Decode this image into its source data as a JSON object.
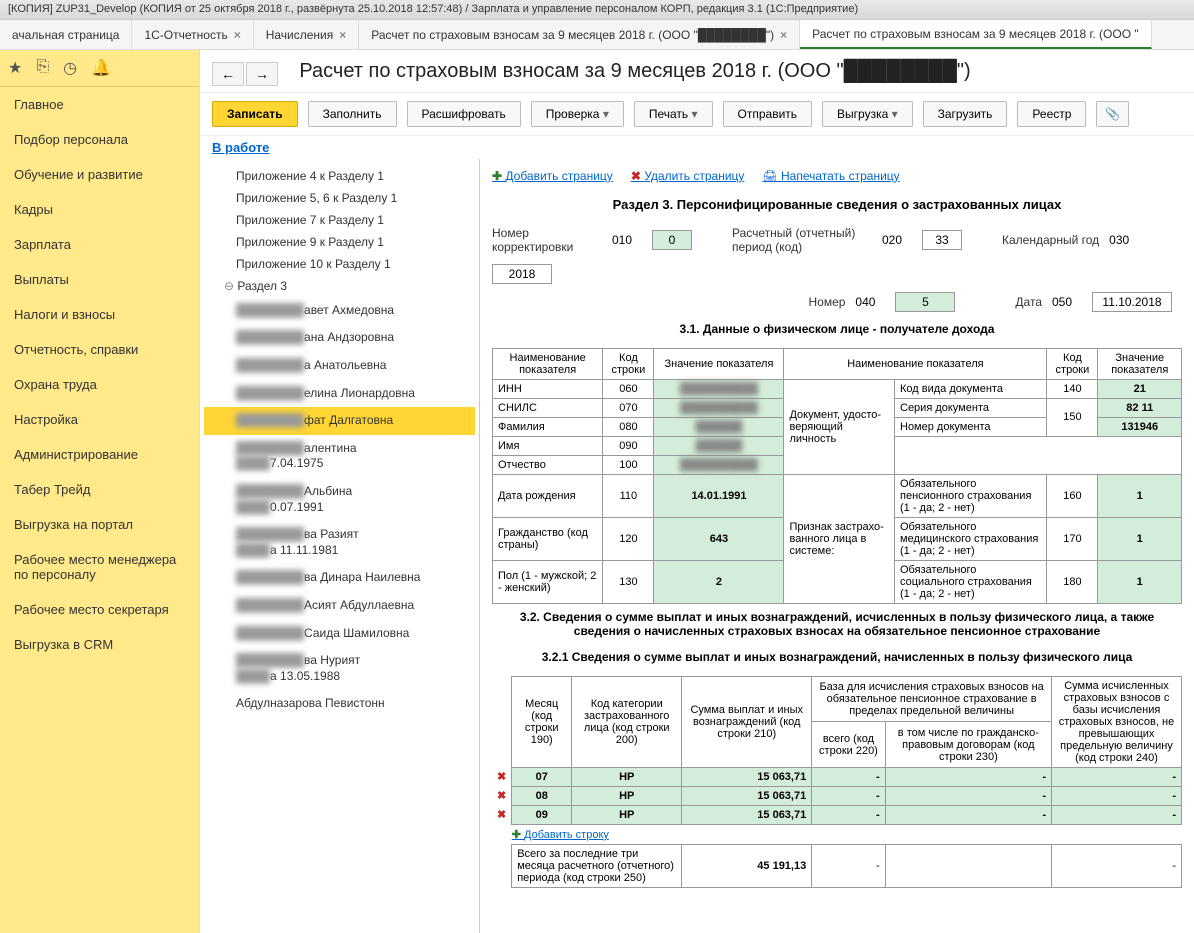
{
  "title_bar": "[КОПИЯ] ZUP31_Develop (КОПИЯ от 25 октября 2018 г., развёрнута 25.10.2018 12:57:48) / Зарплата и управление персоналом КОРП, редакция 3.1  (1С:Предприятие)",
  "tabs": [
    {
      "label": "ачальная страница",
      "closable": false
    },
    {
      "label": "1С-Отчетность",
      "closable": true
    },
    {
      "label": "Начисления",
      "closable": true
    },
    {
      "label": "Расчет по страховым взносам за 9 месяцев 2018 г. (ООО \"████████\")",
      "closable": true
    },
    {
      "label": "Расчет по страховым взносам за 9 месяцев 2018 г. (ООО \"",
      "closable": false,
      "active": true
    }
  ],
  "sidebar": {
    "items": [
      "Главное",
      "Подбор персонала",
      "Обучение и развитие",
      "Кадры",
      "Зарплата",
      "Выплаты",
      "Налоги и взносы",
      "Отчетность, справки",
      "Охрана труда",
      "Настройка",
      "Администрирование",
      "Табер Трейд",
      "Выгрузка на портал",
      "Рабочее место менеджера по персоналу",
      "Рабочее место секретаря",
      "Выгрузка в CRM"
    ]
  },
  "page_title": "Расчет по страховым взносам за 9 месяцев 2018 г. (ООО \"████████\")",
  "toolbar": {
    "save": "Записать",
    "fill": "Заполнить",
    "decode": "Расшифровать",
    "check": "Проверка",
    "print": "Печать",
    "send": "Отправить",
    "export": "Выгрузка",
    "load": "Загрузить",
    "registry": "Реестр"
  },
  "status": "В работе",
  "tree": {
    "items": [
      "Приложение 4 к Разделу 1",
      "Приложение 5, 6 к Разделу 1",
      "Приложение 7 к Разделу 1",
      "Приложение 9 к Разделу 1",
      "Приложение 10 к Разделу 1"
    ],
    "section3": "Раздел 3",
    "persons": [
      {
        "suffix": "авет Ахмедовна"
      },
      {
        "suffix": "ана Андзоровна"
      },
      {
        "suffix": "а Анатольевна"
      },
      {
        "suffix": "елина Лионардовна"
      },
      {
        "suffix": "фат Далгатовна",
        "selected": true
      },
      {
        "suffix": "алентина",
        "sub": "7.04.1975"
      },
      {
        "suffix": "Альбина",
        "sub": "0.07.1991"
      },
      {
        "suffix": "ва Разият",
        "sub": "а 11.11.1981"
      },
      {
        "suffix": "ва Динара Наилевна"
      },
      {
        "suffix": "Асият Абдуллаевна"
      },
      {
        "suffix": "Саида Шамиловна"
      },
      {
        "suffix": "ва Нурият",
        "sub": "а 13.05.1988"
      },
      {
        "suffix": "Абдулназарова Певистонн"
      }
    ]
  },
  "form": {
    "actions": {
      "add": "Добавить страницу",
      "del": "Удалить страницу",
      "print": "Напечатать страницу"
    },
    "section_title": "Раздел 3. Персонифицированные сведения о застрахованных лицах",
    "row1": {
      "corr_label": "Номер корректировки",
      "corr_code": "010",
      "corr_val": "0",
      "period_label": "Расчетный (отчетный) период (код)",
      "period_code": "020",
      "period_val": "33",
      "year_label": "Календарный год",
      "year_code": "030",
      "year_val": "2018"
    },
    "row2": {
      "num_label": "Номер",
      "num_code": "040",
      "num_val": "5",
      "date_label": "Дата",
      "date_code": "050",
      "date_val": "11.10.2018"
    },
    "sub31": "3.1. Данные о физическом лице - получателе дохода",
    "table31": {
      "h1": "Наименование показателя",
      "h2": "Код строки",
      "h3": "Значение показателя",
      "h4": "Наименование показателя",
      "h5": "Код строки",
      "h6": "Значение показателя",
      "rows_left": [
        {
          "name": "ИНН",
          "code": "060"
        },
        {
          "name": "СНИЛС",
          "code": "070"
        },
        {
          "name": "Фамилия",
          "code": "080"
        },
        {
          "name": "Имя",
          "code": "090"
        },
        {
          "name": "Отчество",
          "code": "100"
        },
        {
          "name": "Дата рождения",
          "code": "110",
          "val": "14.01.1991"
        },
        {
          "name": "Гражданство (код страны)",
          "code": "120",
          "val": "643"
        },
        {
          "name": "Пол (1 - мужской; 2 - женский)",
          "code": "130",
          "val": "2"
        }
      ],
      "doc_group": "Документ, удосто­ве­ряющий личность",
      "doc_rows": [
        {
          "name": "Код вида документа",
          "code": "140",
          "val": "21"
        },
        {
          "name": "Серия документа",
          "code": "150",
          "val": "82 11"
        },
        {
          "name": "Номер документа",
          "code": "",
          "val": "131946"
        }
      ],
      "sign_group": "Признак застрахо­ванного лица в системе:",
      "sign_rows": [
        {
          "name": "Обязательного пенсионного страхования (1 - да; 2 - нет)",
          "code": "160",
          "val": "1"
        },
        {
          "name": "Обязательного медицинского страхования (1 - да; 2 - нет)",
          "code": "170",
          "val": "1"
        },
        {
          "name": "Обязательного социального страхования (1 - да; 2 - нет)",
          "code": "180",
          "val": "1"
        }
      ]
    },
    "sub32": "3.2. Сведения о сумме выплат и иных вознаграждений, исчисленных в пользу физического лица, а также сведения о начисленных страховых взносах на обязательное пенсионное страхование",
    "sub321": "3.2.1 Сведения о сумме выплат и иных вознаграждений, начисленных в пользу физического лица",
    "table321": {
      "h_month": "Месяц (код строки 190)",
      "h_cat": "Код категории застрахованного лица (код строки 200)",
      "h_sum": "Сумма выплат и иных вознаграждений (код строки 210)",
      "h_base": "База для исчисления страховых взносов на обязательное пенсионное страхование в пределах предельной величины",
      "h_total": "всего (код строки 220)",
      "h_gpd": "в том числе по гражданско-правовым договорам (код строки 230)",
      "h_calc": "Сумма исчисленных страховых взносов с базы исчисления страховых взносов, не превышающих предельную величину (код строки 240)",
      "rows": [
        {
          "m": "07",
          "cat": "НР",
          "sum": "15 063,71",
          "t": "-",
          "g": "-",
          "c": "-"
        },
        {
          "m": "08",
          "cat": "НР",
          "sum": "15 063,71",
          "t": "-",
          "g": "-",
          "c": "-"
        },
        {
          "m": "09",
          "cat": "НР",
          "sum": "15 063,71",
          "t": "-",
          "g": "-",
          "c": "-"
        }
      ],
      "add_row": "Добавить строку",
      "total_label": "Всего за последние три месяца расчетного (отчетного) периода (код строки 250)",
      "total_sum": "45 191,13",
      "total_dash": "-"
    }
  }
}
